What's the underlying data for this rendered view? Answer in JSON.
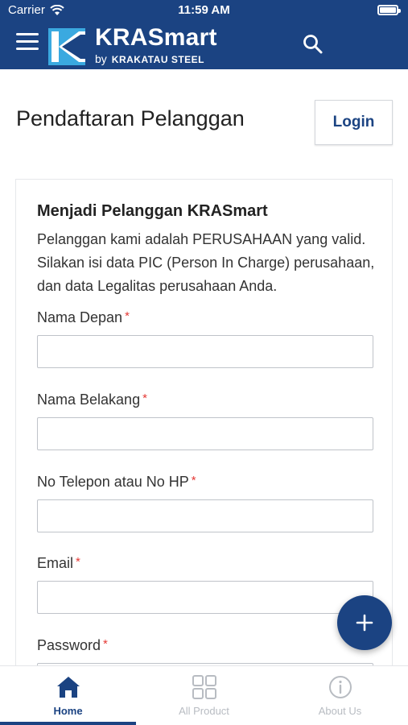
{
  "status_bar": {
    "carrier": "Carrier",
    "time": "11:59 AM"
  },
  "header": {
    "brand_name": "KRASmart",
    "brand_by": "by",
    "brand_company": "KRAKATAU STEEL",
    "icons": {
      "menu": "hamburger-menu-icon",
      "search": "search-icon"
    },
    "color": "#1b4382"
  },
  "page": {
    "title": "Pendaftaran Pelanggan",
    "login_label": "Login"
  },
  "form": {
    "title": "Menjadi Pelanggan KRASmart",
    "description": "Pelanggan kami adalah PERUSAHAAN yang valid. Silakan isi data PIC (Person In Charge) perusahaan, dan data Legalitas perusahaan Anda.",
    "required_mark": "*",
    "fields": [
      {
        "label": "Nama Depan",
        "value": ""
      },
      {
        "label": "Nama Belakang",
        "value": ""
      },
      {
        "label": "No Telepon atau No HP",
        "value": ""
      },
      {
        "label": "Email",
        "value": ""
      },
      {
        "label": "Password",
        "value": ""
      }
    ]
  },
  "fab": {
    "icon": "plus-icon"
  },
  "bottom_nav": {
    "items": [
      {
        "label": "Home",
        "icon": "home-icon",
        "active": true
      },
      {
        "label": "All Product",
        "icon": "grid-icon",
        "active": false
      },
      {
        "label": "About Us",
        "icon": "info-icon",
        "active": false
      }
    ]
  }
}
